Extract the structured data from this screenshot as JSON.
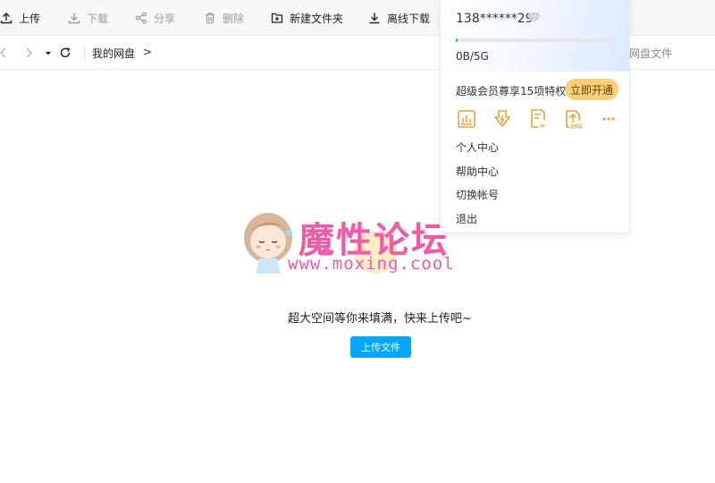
{
  "toolbar": {
    "upload": "上传",
    "download": "下载",
    "share": "分享",
    "delete": "删除",
    "new_folder": "新建文件夹",
    "offline_download": "离线下载"
  },
  "nav": {
    "breadcrumb_root": "我的网盘",
    "breadcrumb_arrow": ">",
    "search_placeholder_partial": "我的网盘文件"
  },
  "empty_state": {
    "watermark_title": "魔性论坛",
    "watermark_url": "www.moxing.cool",
    "message": "超大空间等你来填满，快来上传吧~",
    "upload_button": "上传文件"
  },
  "account_menu": {
    "phone": "138******29",
    "storage_used_fraction": 0.01,
    "storage_label": "0B/5G",
    "vip_text": "超级会员尊享15项特权",
    "vip_button": "立即开通",
    "perk_icons": [
      "chart-icon",
      "fast-download-icon",
      "unlimited-doc-icon",
      "upload-20g-icon",
      "more-icon"
    ],
    "perk_badges": [
      "",
      "",
      "∞",
      "20G",
      ""
    ],
    "items": [
      "个人中心",
      "帮助中心",
      "切换帐号",
      "退出"
    ]
  },
  "colors": {
    "accent_blue": "#06a7ff",
    "vip_gold": "#f8d07a",
    "perk_gold": "#e8a33d",
    "watermark_pink": "#f25aa7",
    "progress_green": "#28c26b"
  }
}
